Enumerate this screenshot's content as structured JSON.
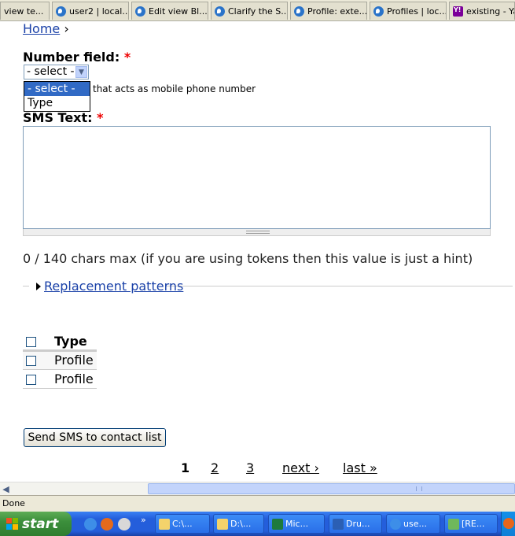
{
  "browser": {
    "tabs": [
      {
        "label": "view te...",
        "icon": "none"
      },
      {
        "label": "user2 | local...",
        "icon": "drupal-icon"
      },
      {
        "label": "Edit view Bl...",
        "icon": "drupal-icon"
      },
      {
        "label": "Clarify the S...",
        "icon": "drupal-icon"
      },
      {
        "label": "Profile: exte...",
        "icon": "drupal-icon"
      },
      {
        "label": "Profiles | loc...",
        "icon": "drupal-icon"
      },
      {
        "label": "existing - Ya...",
        "icon": "yahoo-icon"
      }
    ],
    "status_text": "Done"
  },
  "page": {
    "breadcrumb": {
      "home": "Home",
      "separator": "›"
    },
    "number_field": {
      "label": "Number field:",
      "required_mark": "*",
      "selected": "- select -",
      "options": [
        "- select -",
        "Type"
      ],
      "helper": "that acts as mobile phone number"
    },
    "sms_text": {
      "label": "SMS Text:",
      "required_mark": "*",
      "value": ""
    },
    "chars_info": "0 / 140 chars max (if you are using tokens then this value is just a hint)",
    "replacement_patterns": "Replacement patterns",
    "table": {
      "header": "Type",
      "rows": [
        "Profile",
        "Profile"
      ]
    },
    "send_button": "Send SMS to contact list",
    "pager": {
      "current": "1",
      "pages": [
        "2",
        "3"
      ],
      "next": "next ›",
      "last": "last »"
    }
  },
  "taskbar": {
    "start": "start",
    "more": "»",
    "tasks": [
      "C:\\...",
      "D:\\...",
      "Mic...",
      "Dru...",
      "use...",
      "[RE..."
    ]
  },
  "colors": {
    "link": "#1a41a8",
    "required": "#e00000",
    "selection": "#316ac5",
    "taskbar": "#245edb"
  }
}
